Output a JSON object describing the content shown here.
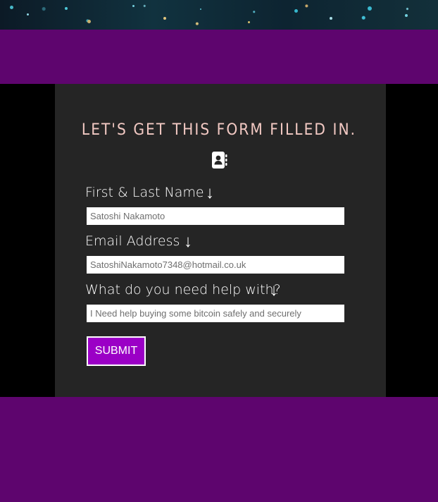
{
  "form": {
    "title": "LET'S GET THIS FORM FILLED IN.",
    "fields": [
      {
        "label": "First & Last Name",
        "value": "Satoshi Nakamoto"
      },
      {
        "label": "Email Address",
        "value": "SatoshiNakamoto7348@hotmail.co.uk"
      },
      {
        "label": "What do you need help with?",
        "value": "I Need help buying some bitcoin safely and securely"
      }
    ],
    "submit_label": "SUBMIT"
  },
  "icons": {
    "header": "address-book-icon",
    "field_arrow": "arrow-down-icon"
  },
  "colors": {
    "page_background": "#5e056e",
    "stage_background": "#000000",
    "card_background": "#252525",
    "title_color": "#f2c9c3",
    "submit_background": "#9b00c6"
  }
}
